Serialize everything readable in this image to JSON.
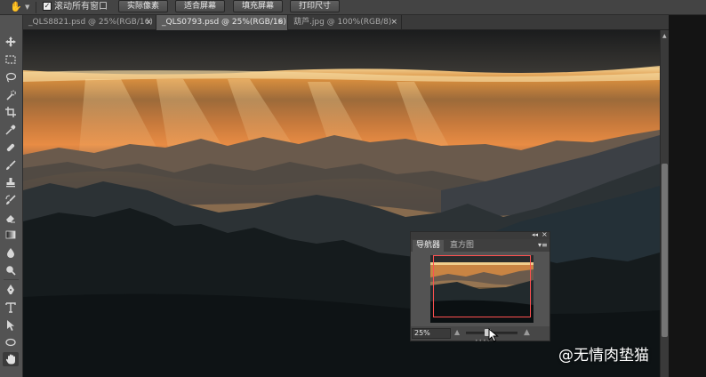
{
  "options_bar": {
    "tool_icon": "hand-icon",
    "scroll_all_checked": true,
    "scroll_all_label": "滚动所有窗口",
    "buttons": [
      "实际像素",
      "适合屏幕",
      "填充屏幕",
      "打印尺寸"
    ]
  },
  "tabs": [
    {
      "label": "_QLS8821.psd @ 25%(RGB/16)",
      "active": false,
      "close": "×"
    },
    {
      "label": "_QLS0793.psd @ 25%(RGB/16)",
      "active": true,
      "close": "×"
    },
    {
      "label": "葫芦.jpg @ 100%(RGB/8)",
      "active": false,
      "close": "×"
    }
  ],
  "toolbar": {
    "tools": [
      "move-icon",
      "marquee-icon",
      "lasso-icon",
      "quick-select-icon",
      "crop-icon",
      "eyedropper-icon",
      "healing-brush-icon",
      "brush-icon",
      "clone-stamp-icon",
      "history-brush-icon",
      "eraser-icon",
      "gradient-icon",
      "blur-icon",
      "dodge-icon",
      "pen-icon",
      "type-icon",
      "path-select-icon",
      "shape-icon",
      "hand-icon"
    ],
    "selected": "hand-icon"
  },
  "navigator": {
    "tabs": [
      "导航器",
      "直方图"
    ],
    "active_tab": "导航器",
    "zoom": "25%",
    "zoom_slider_fraction": 0.42,
    "proxy_color": "#ff5050"
  },
  "watermark": {
    "text": "@无情肉垫猫"
  },
  "colors": {
    "sunset_gold": "#f0a24a",
    "proxy_frame": "#ff5050",
    "ui_panel": "#535353"
  }
}
